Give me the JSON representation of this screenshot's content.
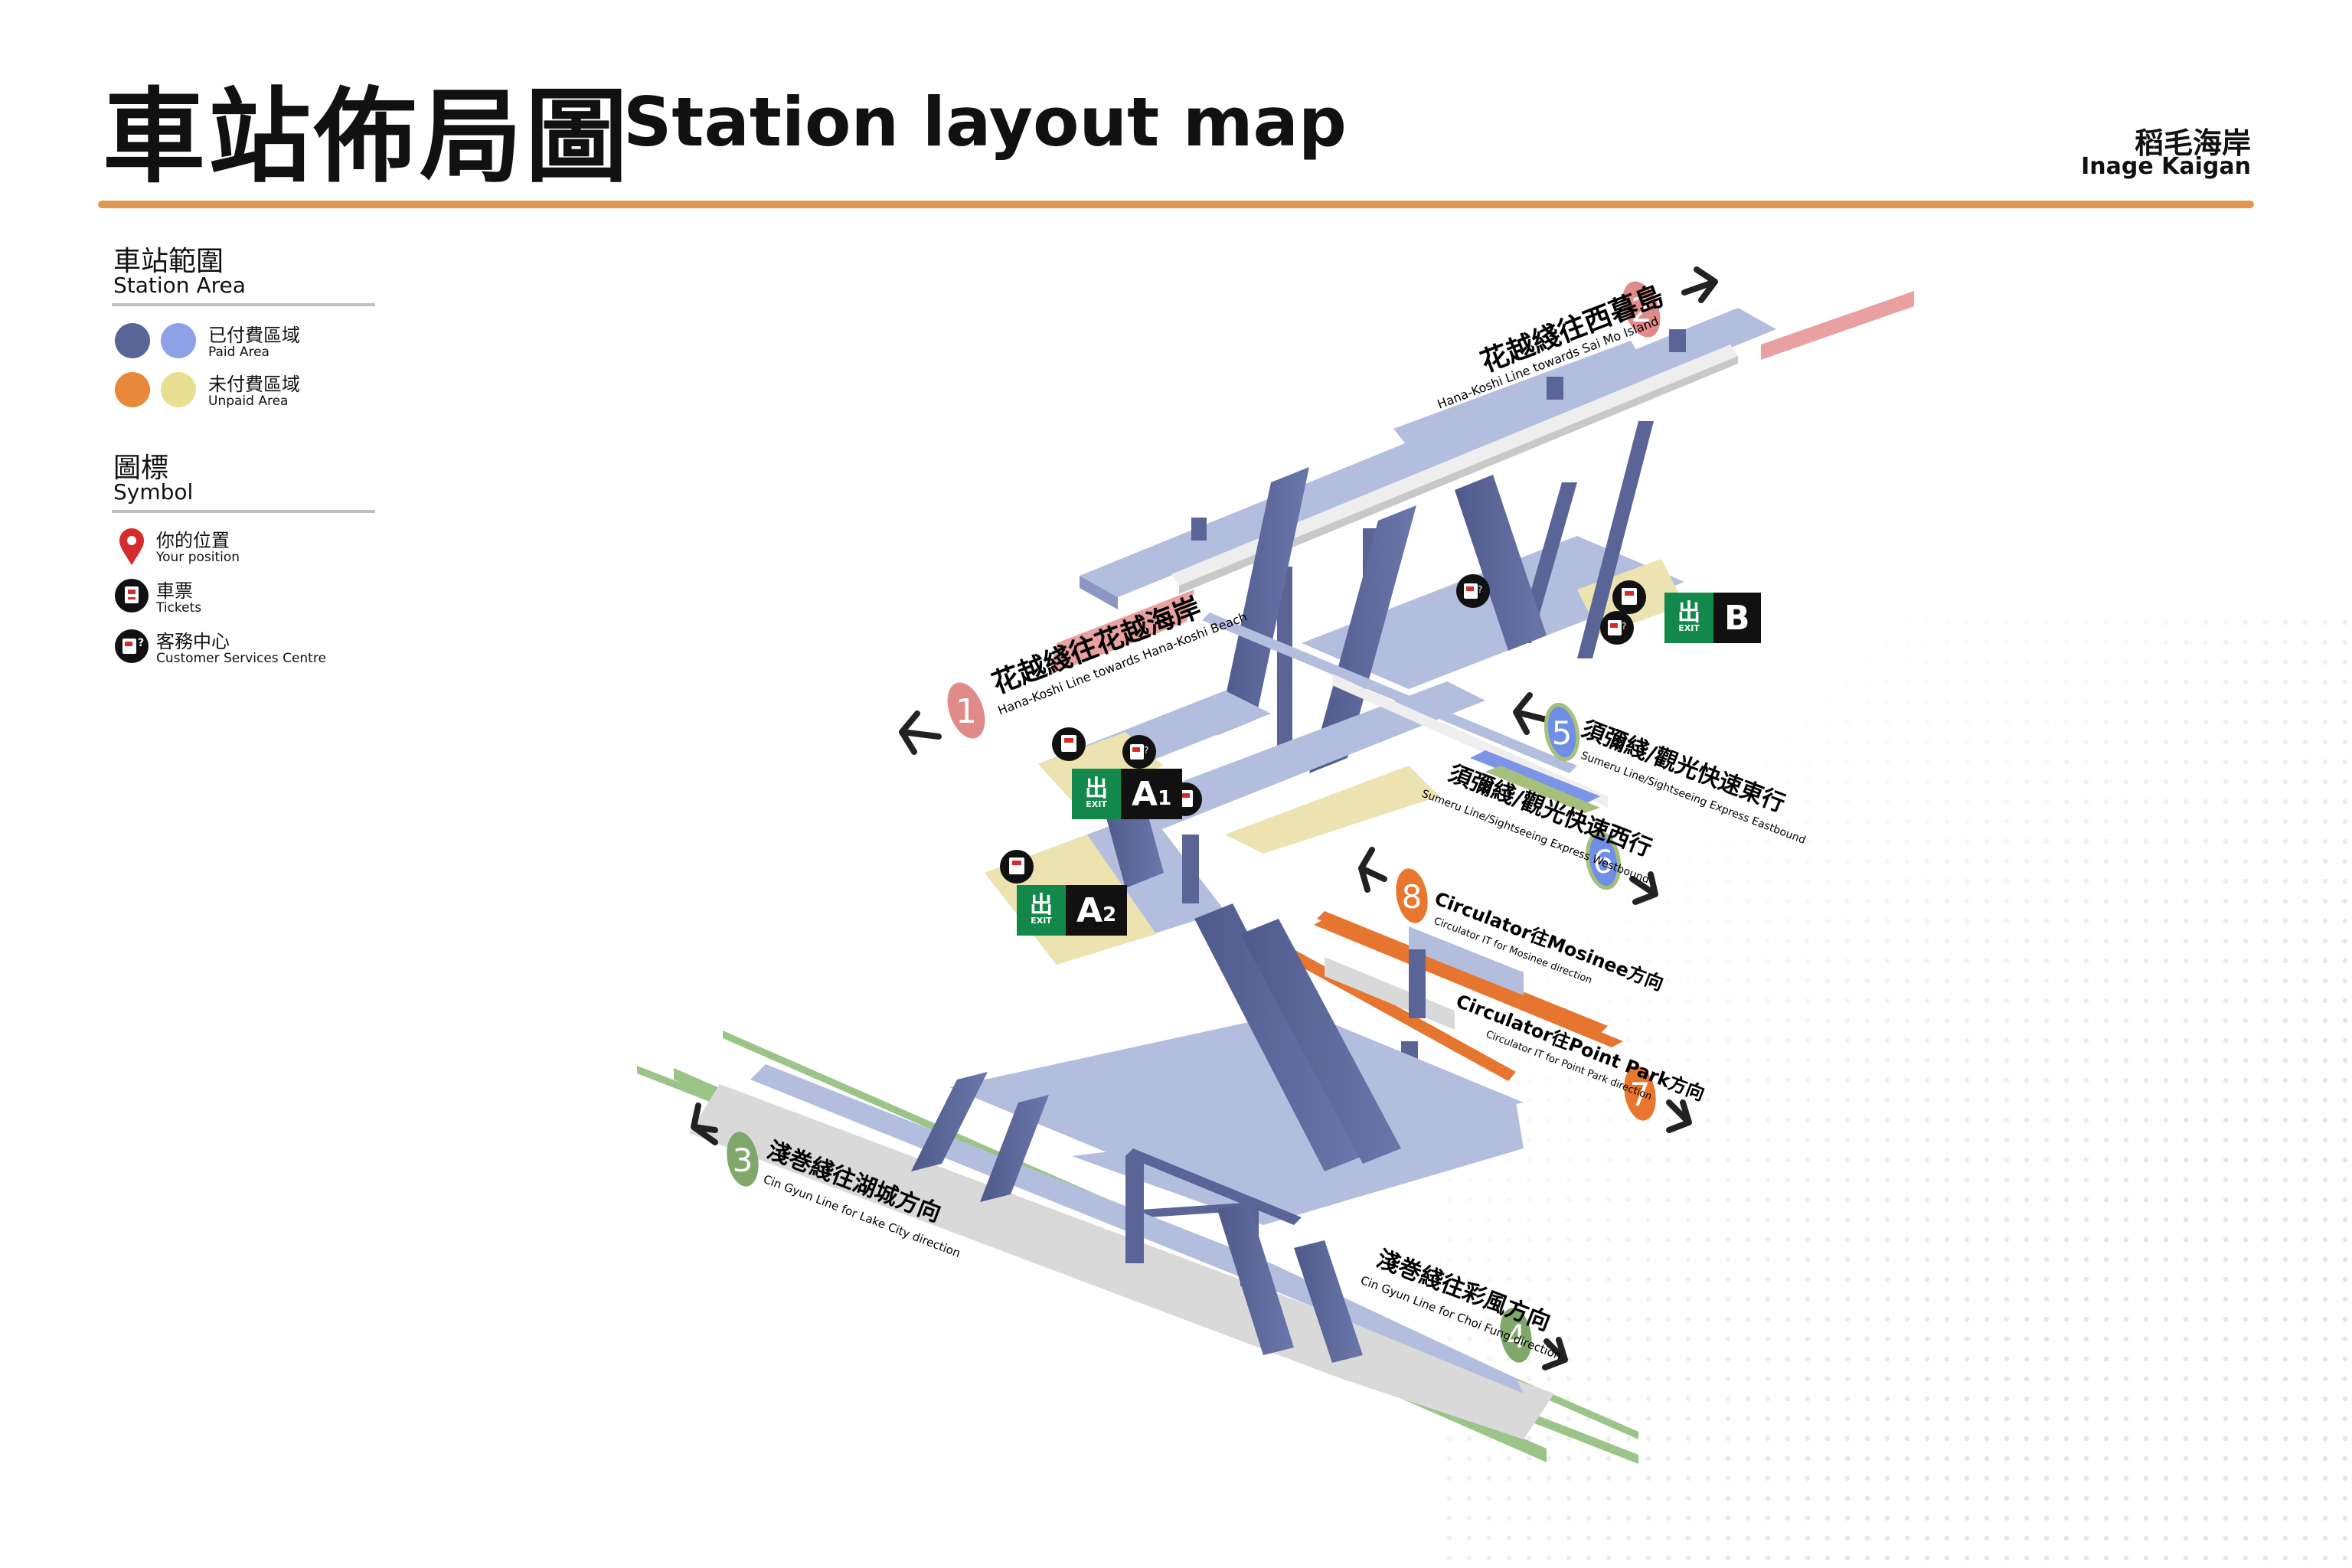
{
  "header": {
    "title_zh": "車站佈局圖",
    "title_en": "Station layout map",
    "station_zh": "稻毛海岸",
    "station_en": "Inage Kaigan"
  },
  "colors": {
    "accent": "#e2994f",
    "paid_dark": "#5b6496",
    "paid_light": "#8ea1e6",
    "unpaid_dark": "#e8883a",
    "unpaid_light": "#e8df90",
    "structure": "#b3bedf",
    "structure_dark": "#5b6496",
    "track_pink": "#e8a0a0",
    "track_orange": "#e6762f",
    "track_green": "#9bc488",
    "track_blue": "#7c95e6",
    "exit_green": "#12894a"
  },
  "legend": {
    "area_title_zh": "車站範圍",
    "area_title_en": "Station Area",
    "paid_zh": "已付費區域",
    "paid_en": "Paid Area",
    "unpaid_zh": "未付費區域",
    "unpaid_en": "Unpaid Area",
    "symbol_title_zh": "圖標",
    "symbol_title_en": "Symbol",
    "symbols": [
      {
        "icon": "location-pin-icon",
        "zh": "你的位置",
        "en": "Your position"
      },
      {
        "icon": "ticket-machine-icon",
        "zh": "車票",
        "en": "Tickets"
      },
      {
        "icon": "customer-service-icon",
        "zh": "客務中心",
        "en": "Customer Services Centre"
      }
    ]
  },
  "platforms": [
    {
      "number": "1",
      "color": "#e08a8a",
      "zh": "花越綫往花越海岸",
      "en": "Hana-Koshi Line towards Hana-Koshi Beach"
    },
    {
      "number": "2",
      "color": "#e08a8a",
      "zh": "花越綫往西暮島",
      "en": "Hana-Koshi Line towards Sai Mo Island"
    },
    {
      "number": "3",
      "color": "#7fa86a",
      "zh": "淺巻綫往湖城方向",
      "en": "Cin Gyun Line for Lake City direction"
    },
    {
      "number": "4",
      "color": "#7fa86a",
      "zh": "淺巻綫往彩風方向",
      "en": "Cin Gyun Line for Choi Fung direction"
    },
    {
      "number": "5",
      "color": "#6f8ee6",
      "zh": "須彌綫/觀光快速東行",
      "en": "Sumeru Line/Sightseeing Express Eastbound"
    },
    {
      "number": "6",
      "color": "#6f8ee6",
      "zh": "須彌綫/觀光快速西行",
      "en": "Sumeru Line/Sightseeing Express Westbound"
    },
    {
      "number": "7",
      "color": "#e8762f",
      "zh": "Circulator往Point Park方向",
      "en": "Circulator IT for Point Park direction"
    },
    {
      "number": "8",
      "color": "#e8762f",
      "zh": "Circulator往Mosinee方向",
      "en": "Circulator IT for Mosinee direction"
    }
  ],
  "exits": [
    {
      "letter": "A",
      "sub": "1",
      "label": "EXIT",
      "glyph": "出"
    },
    {
      "letter": "A",
      "sub": "2",
      "label": "EXIT",
      "glyph": "出"
    },
    {
      "letter": "B",
      "sub": "",
      "label": "EXIT",
      "glyph": "出"
    }
  ]
}
